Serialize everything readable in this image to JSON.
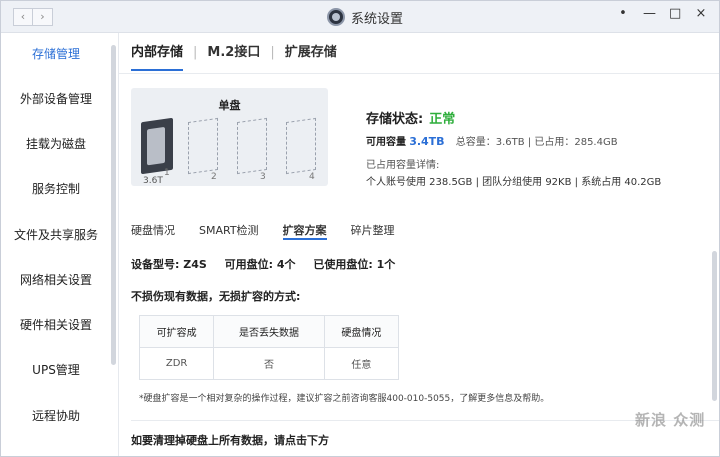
{
  "window": {
    "title": "系统设置",
    "back_icon": "chevron-left-icon",
    "forward_icon": "chevron-right-icon",
    "controls": {
      "menu": "•",
      "minimize": "—",
      "maximize": "□",
      "close": "×"
    }
  },
  "sidebar": {
    "items": [
      {
        "label": "存储管理",
        "active": true
      },
      {
        "label": "外部设备管理"
      },
      {
        "label": "挂载为磁盘"
      },
      {
        "label": "服务控制"
      },
      {
        "label": "文件及共享服务"
      },
      {
        "label": "网络相关设置"
      },
      {
        "label": "硬件相关设置"
      },
      {
        "label": "UPS管理"
      },
      {
        "label": "远程协助"
      }
    ]
  },
  "main": {
    "tabs": [
      {
        "label": "内部存储",
        "active": true
      },
      {
        "label": "M.2接口"
      },
      {
        "label": "扩展存储"
      }
    ],
    "tab_separator": "|",
    "disk": {
      "title": "单盘",
      "slots": [
        "1",
        "2",
        "3",
        "4"
      ],
      "size": "3.6T"
    },
    "status": {
      "label": "存储状态:",
      "value": "正常",
      "available_label": "可用容量",
      "available_value": "3.4TB",
      "total_text": "总容量：3.6TB | 已占用：285.4GB",
      "used_title": "已占用容量详情:",
      "used_detail": "个人账号使用 238.5GB | 团队分组使用 92KB | 系统占用 40.2GB"
    },
    "sub_tabs": [
      {
        "label": "硬盘情况"
      },
      {
        "label": "SMART检测"
      },
      {
        "label": "扩容方案",
        "active": true
      },
      {
        "label": "碎片整理"
      }
    ],
    "model": {
      "model_label": "设备型号:",
      "model_value": "Z4S",
      "free_label": "可用盘位:",
      "free_value": "4个",
      "used_label": "已使用盘位:",
      "used_value": "1个"
    },
    "no_loss_title": "不损伤现有数据，无损扩容的方式:",
    "table": {
      "headers": [
        "可扩容成",
        "是否丢失数据",
        "硬盘情况"
      ],
      "rows": [
        [
          "ZDR",
          "否",
          "任意"
        ]
      ]
    },
    "note": "*硬盘扩容是一个相对复杂的操作过程，建议扩容之前咨询客服400-010-5055，了解更多信息及帮助。",
    "clear_title": "如要清理掉硬盘上所有数据，请点击下方"
  },
  "watermark": "新浪 众测"
}
